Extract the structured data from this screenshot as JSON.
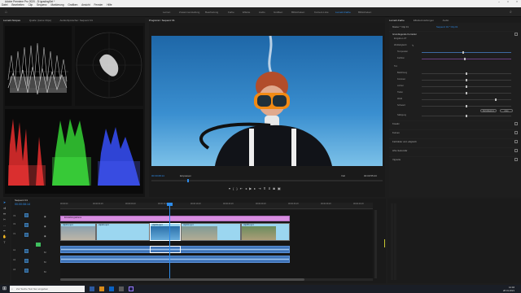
{
  "window": {
    "title": "Adobe Premiere Pro 2020 - D:\\gradingSet *"
  },
  "menubar": {
    "items": [
      "Datei",
      "Bearbeiten",
      "Clip",
      "Sequenz",
      "Markierung",
      "Grafiken",
      "Ansicht",
      "Fenster",
      "Hilfe"
    ]
  },
  "workspaces": {
    "items": [
      "Lernen",
      "Zusammenstellung",
      "Bearbeitung",
      "Farbe",
      "Effekte",
      "Audio",
      "Grafiken",
      "Bibliotheken",
      "Kontext-Liste",
      "Lumetri-Farbe",
      "Bibliotheken"
    ],
    "active_index": 9
  },
  "scopes_panel": {
    "tabs": [
      "Lumetri-Scopes",
      "Quelle: (keine Clips)",
      "Audioclipmischer: Sequenz 01"
    ],
    "active_tab": 0
  },
  "program_monitor": {
    "tab_label": "Programm: Sequenz 01",
    "timecode_left": "00:00:08:14",
    "fit_label": "Einpassen",
    "quality_label": "Voll",
    "timecode_right": "00:00:55:23"
  },
  "lumetri_panel": {
    "tabs": [
      "Lumetri-Farbe",
      "Effekteinstellungen",
      "Audio"
    ],
    "active_tab": 0,
    "header_master": "Master * Clip 01",
    "header_seq": "Sequenz 01 * Clip 01",
    "sections": [
      {
        "label": "Grundlegende Korrektur"
      },
      {
        "label": "Kreativ"
      },
      {
        "label": "Kurven"
      },
      {
        "label": "Farbräder und -abgleich"
      },
      {
        "label": "HSL-Sekundär"
      },
      {
        "label": "Vignette"
      }
    ],
    "rows": [
      {
        "label": "Eingabe-LUT"
      },
      {
        "label": "Weißabgleich"
      },
      {
        "label": "Temperatur"
      },
      {
        "label": "Farbton"
      },
      {
        "label": "Ton"
      },
      {
        "label": "Belichtung"
      },
      {
        "label": "Kontrast"
      },
      {
        "label": "Lichter"
      },
      {
        "label": "Tiefen"
      },
      {
        "label": "Weiß"
      },
      {
        "label": "Schwarz"
      },
      {
        "label": "Sättigung"
      }
    ],
    "buttons": {
      "reset": "Zurücksetzen",
      "auto": "Auto"
    }
  },
  "timeline": {
    "sequence_tab": "Sequenz 01",
    "timecode": "00:00:08:14",
    "ruler": [
      "00:00:00",
      "00:00:04:23",
      "00:00:09:23",
      "00:00:14:23",
      "00:00:19:23",
      "00:00:24:23",
      "00:00:29:23",
      "00:00:34:23",
      "00:00:39:23",
      "00:00:44:23"
    ],
    "video_tracks": [
      "V3",
      "V2",
      "V1"
    ],
    "audio_tracks": [
      "A1",
      "A2",
      "A3"
    ],
    "adjustment_clip": "Einstellungsebene",
    "clips": [
      "clip01.mp4",
      "clip02.mp4",
      "clip03.mp4",
      "clip04.mp4",
      "clip05.mp4"
    ]
  },
  "taskbar": {
    "search_placeholder": "Zur Suche Text hier eingeben",
    "time": "12:46",
    "date": "28.01.2021"
  },
  "colors": {
    "accent": "#2d8ceb",
    "adjustment_layer": "#d88ee0",
    "video_clip": "#9bd6f0",
    "audio_clip": "#3f74b8",
    "playhead": "#2d8ceb"
  }
}
